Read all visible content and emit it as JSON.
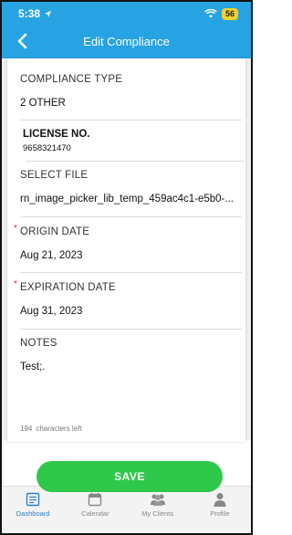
{
  "status": {
    "time": "5:38",
    "battery": "56"
  },
  "header": {
    "title": "Edit Compliance"
  },
  "form": {
    "compliance_type": {
      "label": "COMPLIANCE TYPE",
      "value": "2 OTHER"
    },
    "license": {
      "label": "LICENSE NO.",
      "value": "9658321470"
    },
    "select_file": {
      "label": "SELECT FILE",
      "value": "rn_image_picker_lib_temp_459ac4c1-e5b0-..."
    },
    "origin_date": {
      "required_mark": "*",
      "label": "ORIGIN DATE",
      "value": "Aug 21, 2023"
    },
    "expiration_date": {
      "required_mark": "*",
      "label": "EXPIRATION DATE",
      "value": "Aug 31, 2023"
    },
    "notes": {
      "label": "NOTES",
      "value": "Test;.",
      "chars_left_count": "194",
      "chars_left_text": "characters left"
    }
  },
  "save_label": "SAVE",
  "colors": {
    "header": "#27a3e3",
    "save": "#2ec94a",
    "active_tab": "#2a7fc6",
    "required": "#e0281f"
  },
  "tabs": [
    {
      "label": "Dashboard",
      "icon": "dashboard-icon",
      "active": true
    },
    {
      "label": "Calendar",
      "icon": "calendar-icon",
      "active": false
    },
    {
      "label": "My Clients",
      "icon": "clients-icon",
      "active": false
    },
    {
      "label": "Profile",
      "icon": "profile-icon",
      "active": false
    }
  ]
}
